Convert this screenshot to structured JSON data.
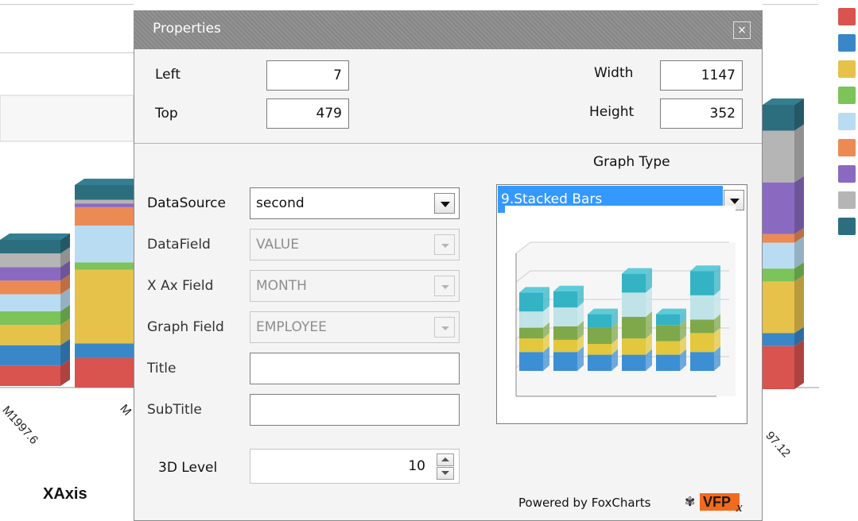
{
  "background_chart": {
    "xaxis_title": "XAxis",
    "tick_labels": [
      "M1997.6",
      "M",
      "97.12"
    ],
    "legend_colors": [
      "#d9534f",
      "#3a87c8",
      "#e6c24b",
      "#7cc35a",
      "#b9dcf2",
      "#ec8a54",
      "#8a6ac0",
      "#b5b5b5",
      "#2d6e7e"
    ]
  },
  "dialog": {
    "title": "Properties",
    "close_label": "×",
    "left_label": "Left",
    "left_value": "7",
    "top_label": "Top",
    "top_value": "479",
    "width_label": "Width",
    "width_value": "1147",
    "height_label": "Height",
    "height_value": "352",
    "datasource_label": "DataSource",
    "datasource_value": "second",
    "datafield_label": "DataField",
    "datafield_value": "VALUE",
    "xaxfield_label": "X Ax Field",
    "xaxfield_value": "MONTH",
    "graphfield_label": "Graph Field",
    "graphfield_value": "EMPLOYEE",
    "title_label": "Title",
    "title_value": "",
    "subtitle_label": "SubTitle",
    "subtitle_value": "",
    "level3d_label": "3D Level",
    "level3d_value": "10",
    "graph_type_label": "Graph Type",
    "graph_type_value": "9.Stacked Bars",
    "powered_by": "Powered by FoxCharts",
    "logo_text": "VFP",
    "logo_suffix": "x"
  }
}
